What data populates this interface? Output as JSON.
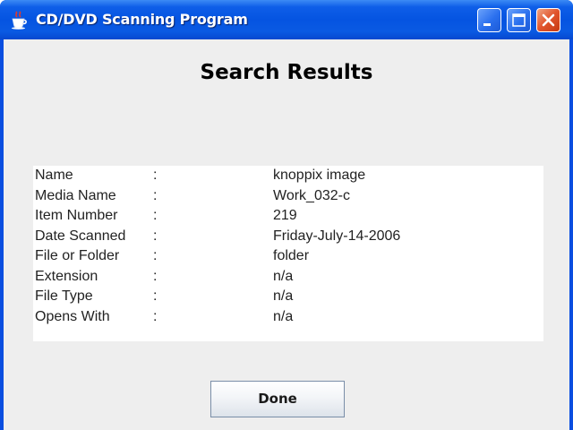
{
  "window": {
    "title": "CD/DVD Scanning Program",
    "icons": {
      "app": "java-coffee-cup-icon",
      "minimize": "minimize-icon",
      "maximize": "maximize-icon",
      "close": "close-icon"
    },
    "colors": {
      "titlebar": "#0554e1",
      "close_button": "#e1542c",
      "client_bg": "#eeeeee"
    }
  },
  "heading": "Search Results",
  "results": [
    {
      "label": "Name",
      "separator": ":",
      "value": "knoppix image"
    },
    {
      "label": "Media Name",
      "separator": ":",
      "value": "Work_032-c"
    },
    {
      "label": "Item Number",
      "separator": ":",
      "value": "219"
    },
    {
      "label": "Date Scanned",
      "separator": ":",
      "value": "Friday-July-14-2006"
    },
    {
      "label": "File or Folder",
      "separator": ":",
      "value": "folder"
    },
    {
      "label": "Extension",
      "separator": ":",
      "value": "n/a"
    },
    {
      "label": "File Type",
      "separator": ":",
      "value": "n/a"
    },
    {
      "label": "Opens With",
      "separator": ":",
      "value": "n/a"
    }
  ],
  "done_label": "Done"
}
